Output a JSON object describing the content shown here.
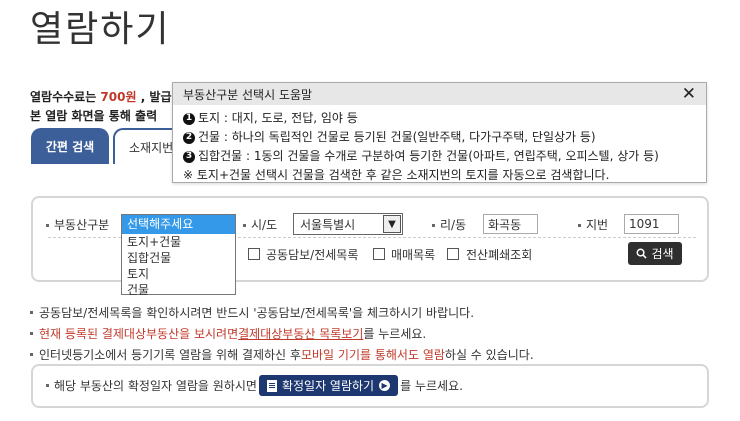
{
  "page": {
    "title": "열람하기",
    "fee_prefix": "열람수수료는 ",
    "fee_amount": "700원",
    "fee_suffix": " , 발급",
    "notice_line": "본 열람 화면을 통해 출력"
  },
  "tabs": [
    {
      "label": "간편 검색"
    },
    {
      "label": "소재지번"
    }
  ],
  "help": {
    "title": "부동산구분 선택시 도움말",
    "close": "✕",
    "items": [
      {
        "num": "1",
        "text": "토지 : 대지, 도로, 전답, 임야 등"
      },
      {
        "num": "2",
        "text": "건물 : 하나의 독립적인 건물로 등기된 건물(일반주택, 다가구주택, 단일상가 등)"
      },
      {
        "num": "3",
        "text": "집합건물 : 1동의 건물을 수개로 구분하여 등기한 건물(아파트, 연립주택, 오피스텔, 상가 등)"
      }
    ],
    "note": "※ 토지+건물 선택시 건물을 검색한 후 같은 소재지번의 토지를 자동으로 검색합니다."
  },
  "form": {
    "property_type_label": "부동산구분",
    "property_type_options": [
      "선택해주세요",
      "토지+건물",
      "집합건물",
      "토지",
      "건물"
    ],
    "city_label": "시/도",
    "city_value": "서울특별시",
    "dong_label": "리/동",
    "dong_value": "화곡동",
    "lot_label": "지번",
    "lot_value": "1091",
    "checkboxes": [
      {
        "label": "공동담보/전세목록"
      },
      {
        "label": "매매목록"
      },
      {
        "label": "전산폐쇄조회"
      }
    ],
    "search_button": "검색"
  },
  "notes": [
    {
      "text": "공동담보/전세목록을 확인하시려면 반드시 '공동담보/전세목록'을 체크하시기 바랍니다."
    },
    {
      "red1": "현재 등록된 결제대상부동산을 보시려면 ",
      "link": "결제대상부동산 목록보기",
      "tail": "를 누르세요."
    },
    {
      "pre": "인터넷등기소에서 등기기록 열람을 위해 결제하신 후 ",
      "red": "모바일 기기를 통해서도 열람",
      "tail": "하실 수 있습니다."
    }
  ],
  "confirm": {
    "prefix": "해당 부동산의 확정일자 열람을 원하시면",
    "button": "확정일자 열람하기",
    "suffix": "를 누르세요."
  }
}
